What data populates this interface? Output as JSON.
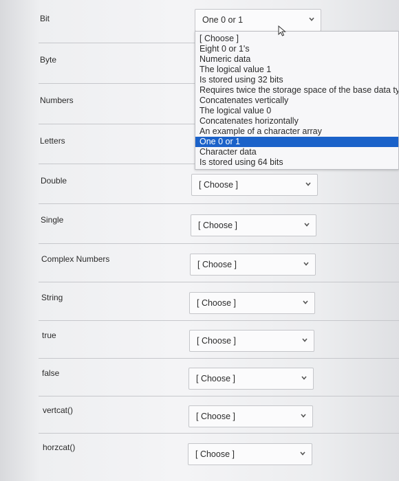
{
  "rows": [
    {
      "term": "Bit",
      "value": "One 0 or 1"
    },
    {
      "term": "Byte"
    },
    {
      "term": "Numbers"
    },
    {
      "term": "Letters"
    },
    {
      "term": "Double",
      "value": "[ Choose ]"
    },
    {
      "term": "Single",
      "value": "[ Choose ]"
    },
    {
      "term": "Complex Numbers",
      "value": "[ Choose ]"
    },
    {
      "term": "String",
      "value": "[ Choose ]"
    },
    {
      "term": "true",
      "value": "[ Choose ]"
    },
    {
      "term": "false",
      "value": "[ Choose ]"
    },
    {
      "term": "vertcat()",
      "value": "[ Choose ]"
    },
    {
      "term": "horzcat()",
      "value": "[ Choose ]"
    }
  ],
  "dropdown": {
    "options": [
      "[ Choose ]",
      "Eight 0 or 1's",
      "Numeric data",
      "The logical value 1",
      "Is stored using 32 bits",
      "Requires twice the storage space of the base data types",
      "Concatenates vertically",
      "The logical value 0",
      "Concatenates horizontally",
      "An example of a character array",
      "One 0 or 1",
      "Character data",
      "Is stored using 64 bits"
    ],
    "selected_index": 10,
    "selected_color": "#1b62c9"
  },
  "icons": {
    "select_arrow": "chevron-down-icon",
    "cursor": "pointer-cursor-icon"
  }
}
